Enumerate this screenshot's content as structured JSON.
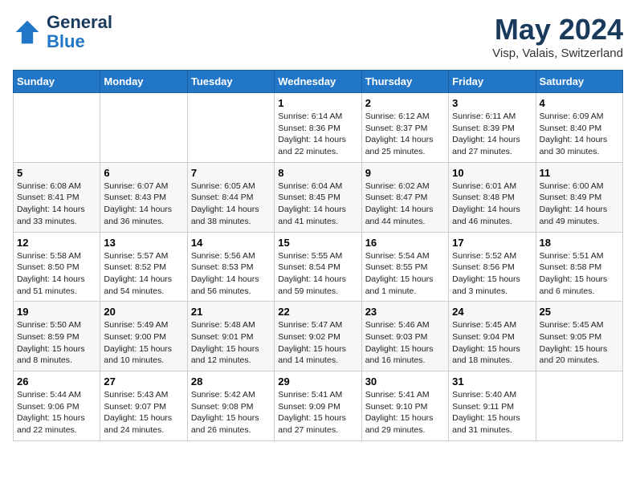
{
  "header": {
    "logo_general": "General",
    "logo_blue": "Blue",
    "title": "May 2024",
    "subtitle": "Visp, Valais, Switzerland"
  },
  "days_of_week": [
    "Sunday",
    "Monday",
    "Tuesday",
    "Wednesday",
    "Thursday",
    "Friday",
    "Saturday"
  ],
  "weeks": [
    [
      {
        "day": "",
        "info": ""
      },
      {
        "day": "",
        "info": ""
      },
      {
        "day": "",
        "info": ""
      },
      {
        "day": "1",
        "info": "Sunrise: 6:14 AM\nSunset: 8:36 PM\nDaylight: 14 hours\nand 22 minutes."
      },
      {
        "day": "2",
        "info": "Sunrise: 6:12 AM\nSunset: 8:37 PM\nDaylight: 14 hours\nand 25 minutes."
      },
      {
        "day": "3",
        "info": "Sunrise: 6:11 AM\nSunset: 8:39 PM\nDaylight: 14 hours\nand 27 minutes."
      },
      {
        "day": "4",
        "info": "Sunrise: 6:09 AM\nSunset: 8:40 PM\nDaylight: 14 hours\nand 30 minutes."
      }
    ],
    [
      {
        "day": "5",
        "info": "Sunrise: 6:08 AM\nSunset: 8:41 PM\nDaylight: 14 hours\nand 33 minutes."
      },
      {
        "day": "6",
        "info": "Sunrise: 6:07 AM\nSunset: 8:43 PM\nDaylight: 14 hours\nand 36 minutes."
      },
      {
        "day": "7",
        "info": "Sunrise: 6:05 AM\nSunset: 8:44 PM\nDaylight: 14 hours\nand 38 minutes."
      },
      {
        "day": "8",
        "info": "Sunrise: 6:04 AM\nSunset: 8:45 PM\nDaylight: 14 hours\nand 41 minutes."
      },
      {
        "day": "9",
        "info": "Sunrise: 6:02 AM\nSunset: 8:47 PM\nDaylight: 14 hours\nand 44 minutes."
      },
      {
        "day": "10",
        "info": "Sunrise: 6:01 AM\nSunset: 8:48 PM\nDaylight: 14 hours\nand 46 minutes."
      },
      {
        "day": "11",
        "info": "Sunrise: 6:00 AM\nSunset: 8:49 PM\nDaylight: 14 hours\nand 49 minutes."
      }
    ],
    [
      {
        "day": "12",
        "info": "Sunrise: 5:58 AM\nSunset: 8:50 PM\nDaylight: 14 hours\nand 51 minutes."
      },
      {
        "day": "13",
        "info": "Sunrise: 5:57 AM\nSunset: 8:52 PM\nDaylight: 14 hours\nand 54 minutes."
      },
      {
        "day": "14",
        "info": "Sunrise: 5:56 AM\nSunset: 8:53 PM\nDaylight: 14 hours\nand 56 minutes."
      },
      {
        "day": "15",
        "info": "Sunrise: 5:55 AM\nSunset: 8:54 PM\nDaylight: 14 hours\nand 59 minutes."
      },
      {
        "day": "16",
        "info": "Sunrise: 5:54 AM\nSunset: 8:55 PM\nDaylight: 15 hours\nand 1 minute."
      },
      {
        "day": "17",
        "info": "Sunrise: 5:52 AM\nSunset: 8:56 PM\nDaylight: 15 hours\nand 3 minutes."
      },
      {
        "day": "18",
        "info": "Sunrise: 5:51 AM\nSunset: 8:58 PM\nDaylight: 15 hours\nand 6 minutes."
      }
    ],
    [
      {
        "day": "19",
        "info": "Sunrise: 5:50 AM\nSunset: 8:59 PM\nDaylight: 15 hours\nand 8 minutes."
      },
      {
        "day": "20",
        "info": "Sunrise: 5:49 AM\nSunset: 9:00 PM\nDaylight: 15 hours\nand 10 minutes."
      },
      {
        "day": "21",
        "info": "Sunrise: 5:48 AM\nSunset: 9:01 PM\nDaylight: 15 hours\nand 12 minutes."
      },
      {
        "day": "22",
        "info": "Sunrise: 5:47 AM\nSunset: 9:02 PM\nDaylight: 15 hours\nand 14 minutes."
      },
      {
        "day": "23",
        "info": "Sunrise: 5:46 AM\nSunset: 9:03 PM\nDaylight: 15 hours\nand 16 minutes."
      },
      {
        "day": "24",
        "info": "Sunrise: 5:45 AM\nSunset: 9:04 PM\nDaylight: 15 hours\nand 18 minutes."
      },
      {
        "day": "25",
        "info": "Sunrise: 5:45 AM\nSunset: 9:05 PM\nDaylight: 15 hours\nand 20 minutes."
      }
    ],
    [
      {
        "day": "26",
        "info": "Sunrise: 5:44 AM\nSunset: 9:06 PM\nDaylight: 15 hours\nand 22 minutes."
      },
      {
        "day": "27",
        "info": "Sunrise: 5:43 AM\nSunset: 9:07 PM\nDaylight: 15 hours\nand 24 minutes."
      },
      {
        "day": "28",
        "info": "Sunrise: 5:42 AM\nSunset: 9:08 PM\nDaylight: 15 hours\nand 26 minutes."
      },
      {
        "day": "29",
        "info": "Sunrise: 5:41 AM\nSunset: 9:09 PM\nDaylight: 15 hours\nand 27 minutes."
      },
      {
        "day": "30",
        "info": "Sunrise: 5:41 AM\nSunset: 9:10 PM\nDaylight: 15 hours\nand 29 minutes."
      },
      {
        "day": "31",
        "info": "Sunrise: 5:40 AM\nSunset: 9:11 PM\nDaylight: 15 hours\nand 31 minutes."
      },
      {
        "day": "",
        "info": ""
      }
    ]
  ]
}
